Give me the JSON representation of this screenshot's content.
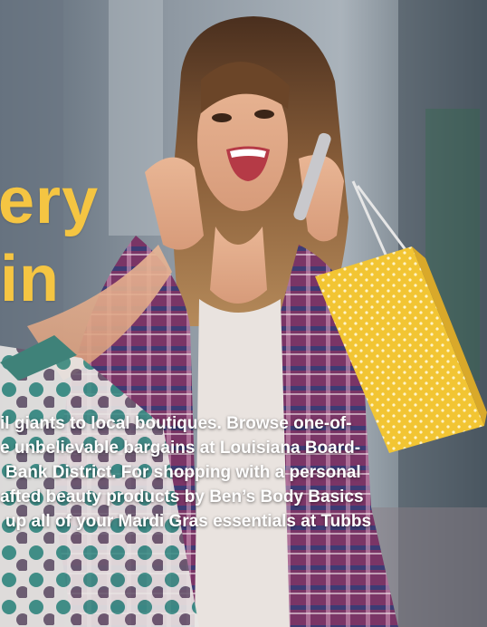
{
  "headline": {
    "line1": "ery",
    "line2": "in"
  },
  "body_lines": [
    "il giants to local boutiques. Browse one-of-",
    "e unbelievable bargains at Louisiana Board-",
    "Bank District. For shopping with a personal",
    "afted beauty products by Ben’s Body Basics",
    "up all of your Mardi Gras essentials at Tubbs"
  ],
  "colors": {
    "headline": "#f5c542",
    "body_text": "#ffffff",
    "yellow_bag": "#f2c533",
    "plaid_shirt": "#8b3e77"
  }
}
